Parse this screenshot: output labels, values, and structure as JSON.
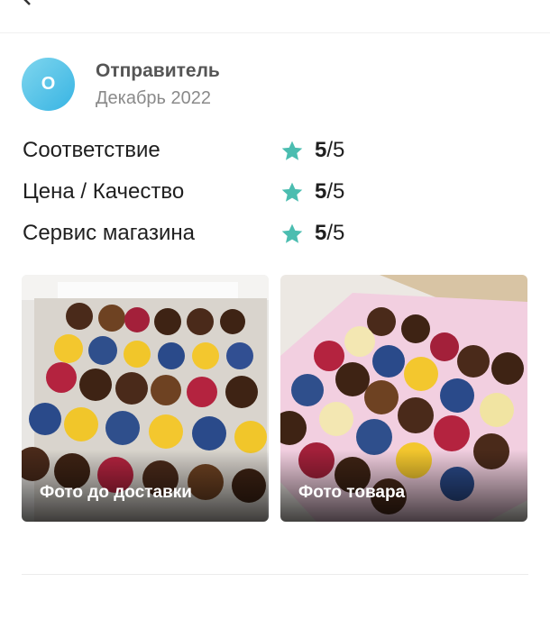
{
  "header": {
    "back_icon": "chevron-left-icon"
  },
  "review": {
    "avatar_letter": "О",
    "reviewer_name": "Отправитель",
    "date": "Декабрь 2022",
    "ratings": [
      {
        "label": "Соответствие",
        "score": "5",
        "max": "/5"
      },
      {
        "label": "Цена / Качество",
        "score": "5",
        "max": "/5"
      },
      {
        "label": "Сервис магазина",
        "score": "5",
        "max": "/5"
      }
    ],
    "star_icon": "star-icon",
    "star_color": "#4bbdb0",
    "photos": [
      {
        "caption": "Фото до доставки"
      },
      {
        "caption": "Фото товара"
      }
    ]
  }
}
